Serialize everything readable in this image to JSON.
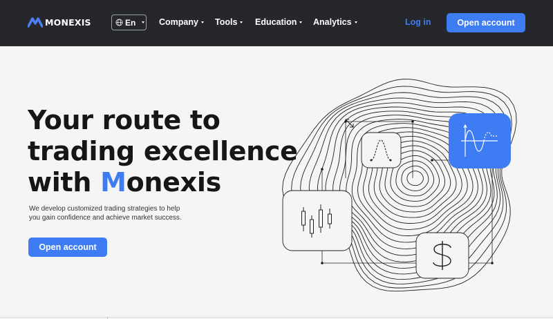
{
  "brand": {
    "name": "MONEXIS",
    "accent": "#3d7cf2",
    "nav_bg": "#25272b"
  },
  "nav": {
    "language": "En",
    "items": [
      {
        "label": "Company",
        "icon": "chevron-down-icon"
      },
      {
        "label": "Tools",
        "icon": "chevron-down-icon"
      },
      {
        "label": "Education",
        "icon": "chevron-down-icon"
      },
      {
        "label": "Analytics",
        "icon": "chevron-down-icon"
      }
    ],
    "login": "Log in",
    "open_account": "Open account"
  },
  "hero": {
    "title_line1": "Your route to",
    "title_line2": "trading excellence",
    "title_line3_prefix": "with ",
    "title_accent_letter": "M",
    "title_line3_rest": "onexis",
    "subtitle": "We develop customized trading strategies to help you gain confidence and achieve market success.",
    "cta": "Open account"
  },
  "illustration": {
    "cards": [
      {
        "icon": "bell-curve-chart-icon"
      },
      {
        "icon": "sine-wave-chart-icon"
      },
      {
        "icon": "candlestick-chart-icon"
      },
      {
        "icon": "dollar-icon"
      }
    ],
    "expand_icon": "diagonal-arrows-icon"
  }
}
